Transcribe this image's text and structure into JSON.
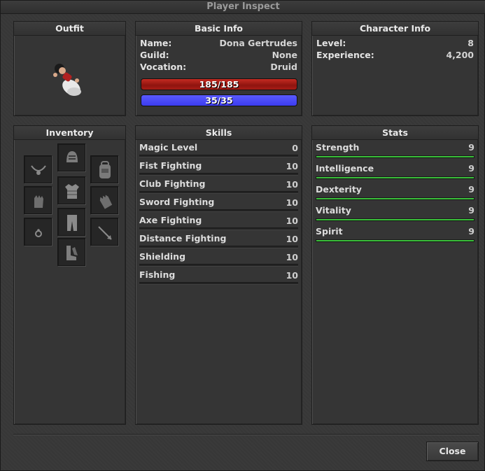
{
  "window": {
    "title": "Player Inspect"
  },
  "outfit": {
    "header": "Outfit"
  },
  "basic_info": {
    "header": "Basic Info",
    "name_label": "Name:",
    "name_value": "Dona Gertrudes",
    "guild_label": "Guild:",
    "guild_value": "None",
    "vocation_label": "Vocation:",
    "vocation_value": "Druid",
    "health_text": "185/185",
    "health_fraction": 1.0,
    "mana_text": "35/35",
    "mana_fraction": 1.0
  },
  "character_info": {
    "header": "Character Info",
    "level_label": "Level:",
    "level_value": "8",
    "experience_label": "Experience:",
    "experience_value": "4,200"
  },
  "inventory": {
    "header": "Inventory",
    "slots": [
      "necklace",
      "helmet",
      "backpack",
      "gloves",
      "armor",
      "gloves",
      "ring",
      "legs",
      "arrow",
      "boots"
    ]
  },
  "skills": {
    "header": "Skills",
    "items": [
      {
        "name": "Magic Level",
        "value": "0",
        "progress": 0
      },
      {
        "name": "Fist Fighting",
        "value": "10",
        "progress": 0
      },
      {
        "name": "Club Fighting",
        "value": "10",
        "progress": 0
      },
      {
        "name": "Sword Fighting",
        "value": "10",
        "progress": 0
      },
      {
        "name": "Axe Fighting",
        "value": "10",
        "progress": 0
      },
      {
        "name": "Distance Fighting",
        "value": "10",
        "progress": 0
      },
      {
        "name": "Shielding",
        "value": "10",
        "progress": 0
      },
      {
        "name": "Fishing",
        "value": "10",
        "progress": 0
      }
    ]
  },
  "stats": {
    "header": "Stats",
    "items": [
      {
        "name": "Strength",
        "value": "9",
        "progress": 1.0
      },
      {
        "name": "Intelligence",
        "value": "9",
        "progress": 1.0
      },
      {
        "name": "Dexterity",
        "value": "9",
        "progress": 1.0
      },
      {
        "name": "Vitality",
        "value": "9",
        "progress": 1.0
      },
      {
        "name": "Spirit",
        "value": "9",
        "progress": 1.0
      }
    ]
  },
  "footer": {
    "close_label": "Close"
  },
  "colors": {
    "health": "#a81c15",
    "mana": "#4646f5",
    "stat_bar": "#3fbf3f"
  }
}
